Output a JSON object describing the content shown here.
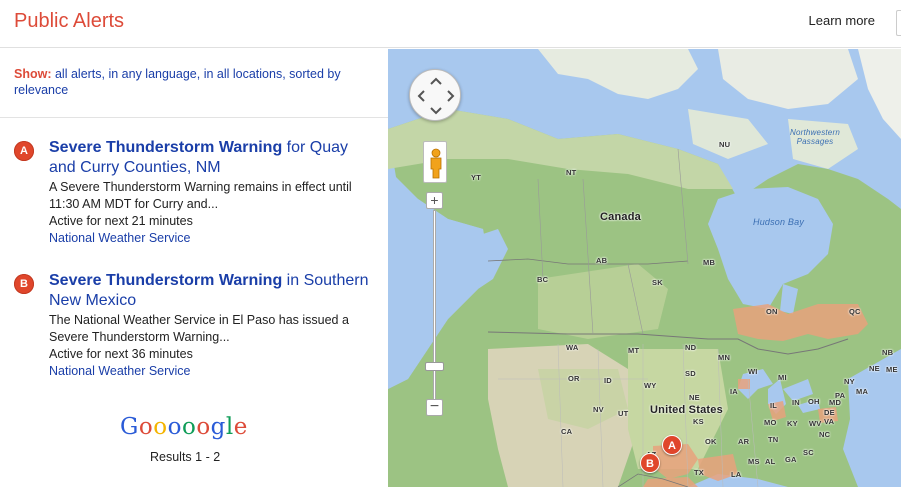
{
  "header": {
    "title": "Public Alerts",
    "learn_more": "Learn more"
  },
  "show": {
    "label": "Show:",
    "text": "all alerts, in any language, in all locations, sorted by relevance"
  },
  "alerts": [
    {
      "marker": "A",
      "title_bold": "Severe Thunderstorm Warning",
      "title_rest": " for Quay and Curry Counties, NM",
      "description": "A Severe Thunderstorm Warning remains in effect until 11:30 AM MDT for Curry and...",
      "active": "Active for next 21 minutes",
      "source": "National Weather Service"
    },
    {
      "marker": "B",
      "title_bold": "Severe Thunderstorm Warning",
      "title_rest": " in Southern New Mexico",
      "description": "The National Weather Service in El Paso has issued a Severe Thunderstorm Warning...",
      "active": "Active for next 36 minutes",
      "source": "National Weather Service"
    }
  ],
  "pager": {
    "logo_letters": [
      "G",
      "o",
      "o",
      "o",
      "o",
      "o",
      "g",
      "l",
      "e"
    ],
    "logo_colors": [
      "#2a5bd7",
      "#dd4b39",
      "#f4b400",
      "#2a5bd7",
      "#0f9d58",
      "#dd4b39",
      "#2a5bd7",
      "#0f9d58",
      "#dd4b39"
    ],
    "results": "Results 1 - 2"
  },
  "map": {
    "labels": {
      "canada": "Canada",
      "united_states": "United States",
      "hudson_bay": "Hudson Bay",
      "northwestern_passages": "Northwestern Passages",
      "nu": "NU",
      "nt": "NT",
      "yt": "YT",
      "bc": "BC",
      "ab": "AB",
      "sk": "SK",
      "mb": "MB",
      "on": "ON",
      "qc": "QC",
      "nb": "NB",
      "ne_ca": "NE",
      "wa": "WA",
      "or": "OR",
      "ca": "CA",
      "nv": "NV",
      "id": "ID",
      "mt": "MT",
      "wy": "WY",
      "ut": "UT",
      "az": "AZ",
      "nd": "ND",
      "sd": "SD",
      "ne": "NE",
      "ks": "KS",
      "ok": "OK",
      "tx": "TX",
      "mn": "MN",
      "ia": "IA",
      "mo": "MO",
      "ar": "AR",
      "la": "LA",
      "ms": "MS",
      "al": "AL",
      "ga": "GA",
      "tn": "TN",
      "ky": "KY",
      "il": "IL",
      "in": "IN",
      "oh": "OH",
      "wi": "WI",
      "mi": "MI",
      "pa": "PA",
      "ny": "NY",
      "ma": "MA",
      "wv": "WV",
      "va": "VA",
      "nc": "NC",
      "sc": "SC",
      "md": "MD",
      "de": "DE",
      "me": "ME"
    },
    "markers": [
      "A",
      "B"
    ],
    "zoom_in": "+",
    "zoom_out": "−"
  }
}
